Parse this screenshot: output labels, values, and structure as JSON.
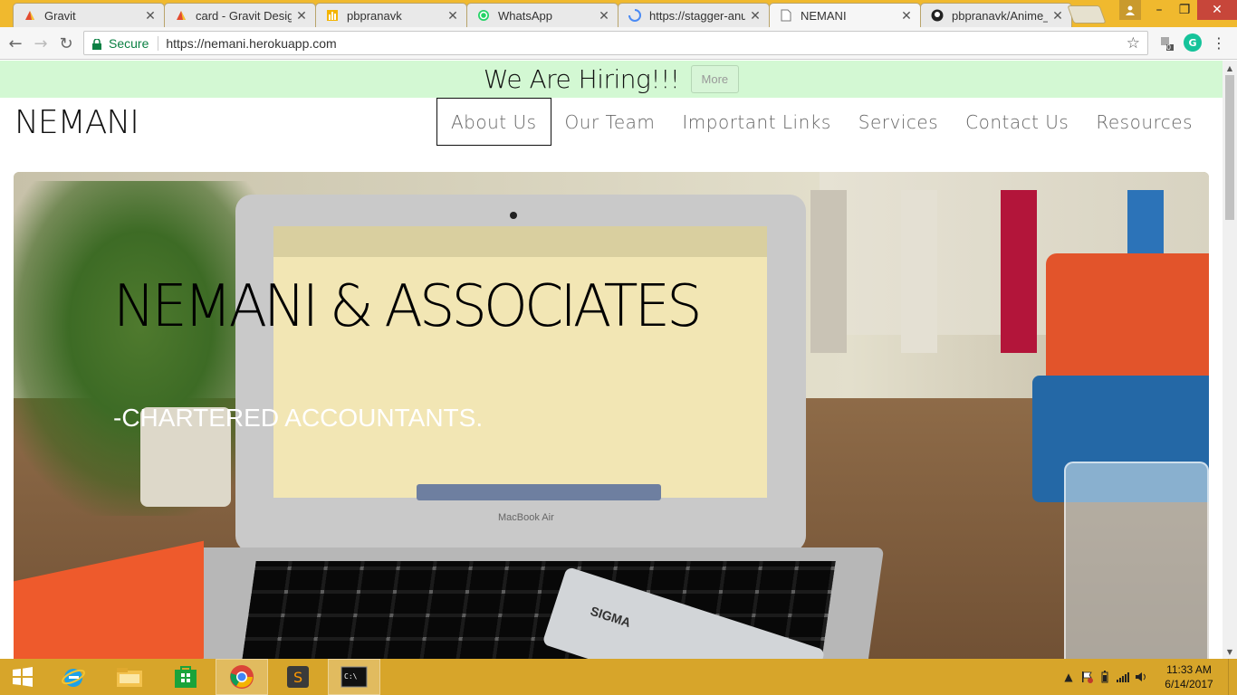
{
  "browser": {
    "tabs": [
      {
        "title": "Gravit",
        "icon": "gravit-icon"
      },
      {
        "title": "card - Gravit Design",
        "icon": "gravit-icon"
      },
      {
        "title": "pbpranavk",
        "icon": "bar-chart-icon"
      },
      {
        "title": "WhatsApp",
        "icon": "whatsapp-icon"
      },
      {
        "title": "https://stagger-anu",
        "icon": "loading-icon"
      },
      {
        "title": "NEMANI",
        "icon": "page-icon"
      },
      {
        "title": "pbpranavk/Anime_F",
        "icon": "github-icon"
      }
    ],
    "active_tab": 5,
    "address": {
      "secure_label": "Secure",
      "url": "https://nemani.herokuapp.com"
    },
    "extension_badge": "0",
    "extension_g": "G"
  },
  "page": {
    "hiring": {
      "headline": "We Are Hiring!!!",
      "more_label": "More"
    },
    "brand": "NEMANI",
    "nav": [
      {
        "label": "About Us",
        "active": true
      },
      {
        "label": "Our Team",
        "active": false
      },
      {
        "label": "Important Links",
        "active": false
      },
      {
        "label": "Services",
        "active": false
      },
      {
        "label": "Contact Us",
        "active": false
      },
      {
        "label": "Resources",
        "active": false
      }
    ],
    "hero": {
      "heading": "NEMANI & ASSOCIATES",
      "subheading": "-CHARTERED ACCOUNTANTS.",
      "laptop_label": "MacBook Air",
      "calculator_label": "SIGMA"
    }
  },
  "taskbar": {
    "clock_time": "11:33 AM",
    "clock_date": "6/14/2017",
    "accent_color": "#d7a52a"
  }
}
